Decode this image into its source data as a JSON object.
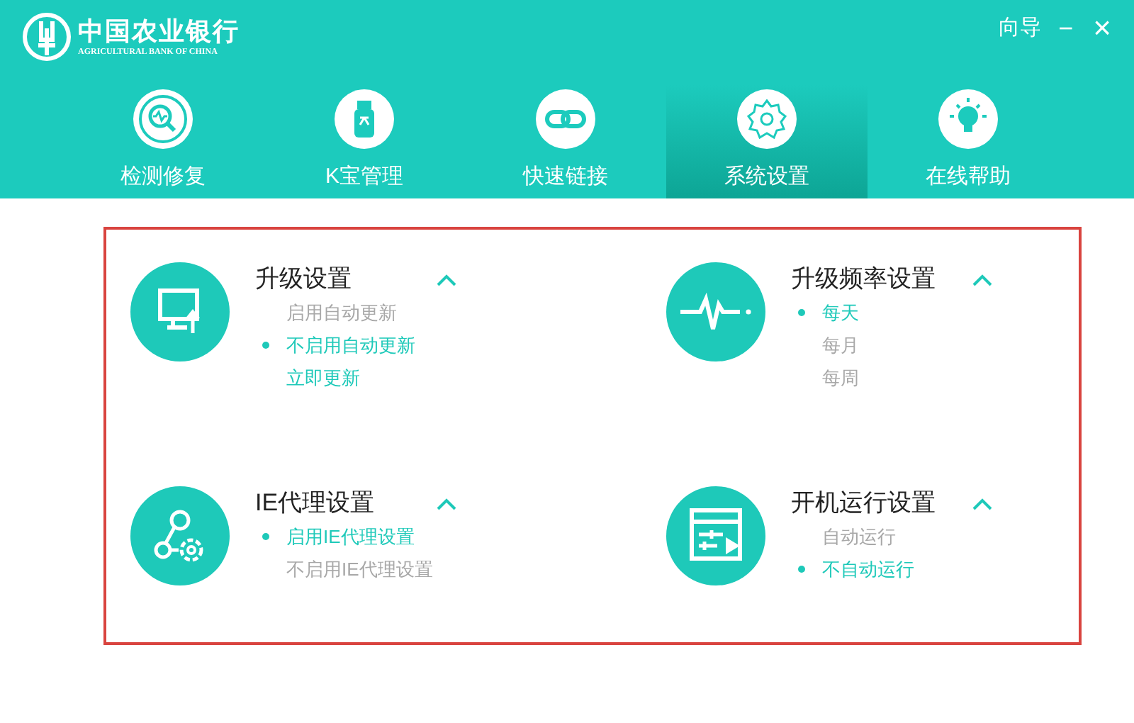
{
  "header": {
    "brand": "中国农业银行",
    "brand_subtitle": "AGRICULTURAL BANK OF CHINA",
    "guide": "向导",
    "minimize": "−",
    "close": "×"
  },
  "tabs": [
    {
      "label": "检测修复",
      "kind": "scan",
      "selected": false
    },
    {
      "label": "K宝管理",
      "kind": "usbkey",
      "selected": false
    },
    {
      "label": "快速链接",
      "kind": "link",
      "selected": false
    },
    {
      "label": "系统设置",
      "kind": "gear",
      "selected": true
    },
    {
      "label": "在线帮助",
      "kind": "bulb",
      "selected": false
    }
  ],
  "sections": [
    {
      "title": "升级设置",
      "kind": "monitor",
      "expanded": true,
      "options": [
        {
          "label": "启用自动更新",
          "kind": "radio",
          "selected": false
        },
        {
          "label": "不启用自动更新",
          "kind": "radio",
          "selected": true
        },
        {
          "label": "立即更新",
          "kind": "link",
          "selected": false
        }
      ]
    },
    {
      "title": "升级频率设置",
      "kind": "pulse",
      "expanded": true,
      "options": [
        {
          "label": "每天",
          "kind": "radio",
          "selected": true
        },
        {
          "label": "每月",
          "kind": "radio",
          "selected": false
        },
        {
          "label": "每周",
          "kind": "radio",
          "selected": false
        }
      ]
    },
    {
      "title": "IE代理设置",
      "kind": "network",
      "expanded": true,
      "options": [
        {
          "label": "启用IE代理设置",
          "kind": "radio",
          "selected": true
        },
        {
          "label": "不启用IE代理设置",
          "kind": "radio",
          "selected": false
        }
      ]
    },
    {
      "title": "开机运行设置",
      "kind": "startup",
      "expanded": true,
      "options": [
        {
          "label": "自动运行",
          "kind": "radio",
          "selected": false
        },
        {
          "label": "不自动运行",
          "kind": "radio",
          "selected": true
        }
      ]
    }
  ]
}
